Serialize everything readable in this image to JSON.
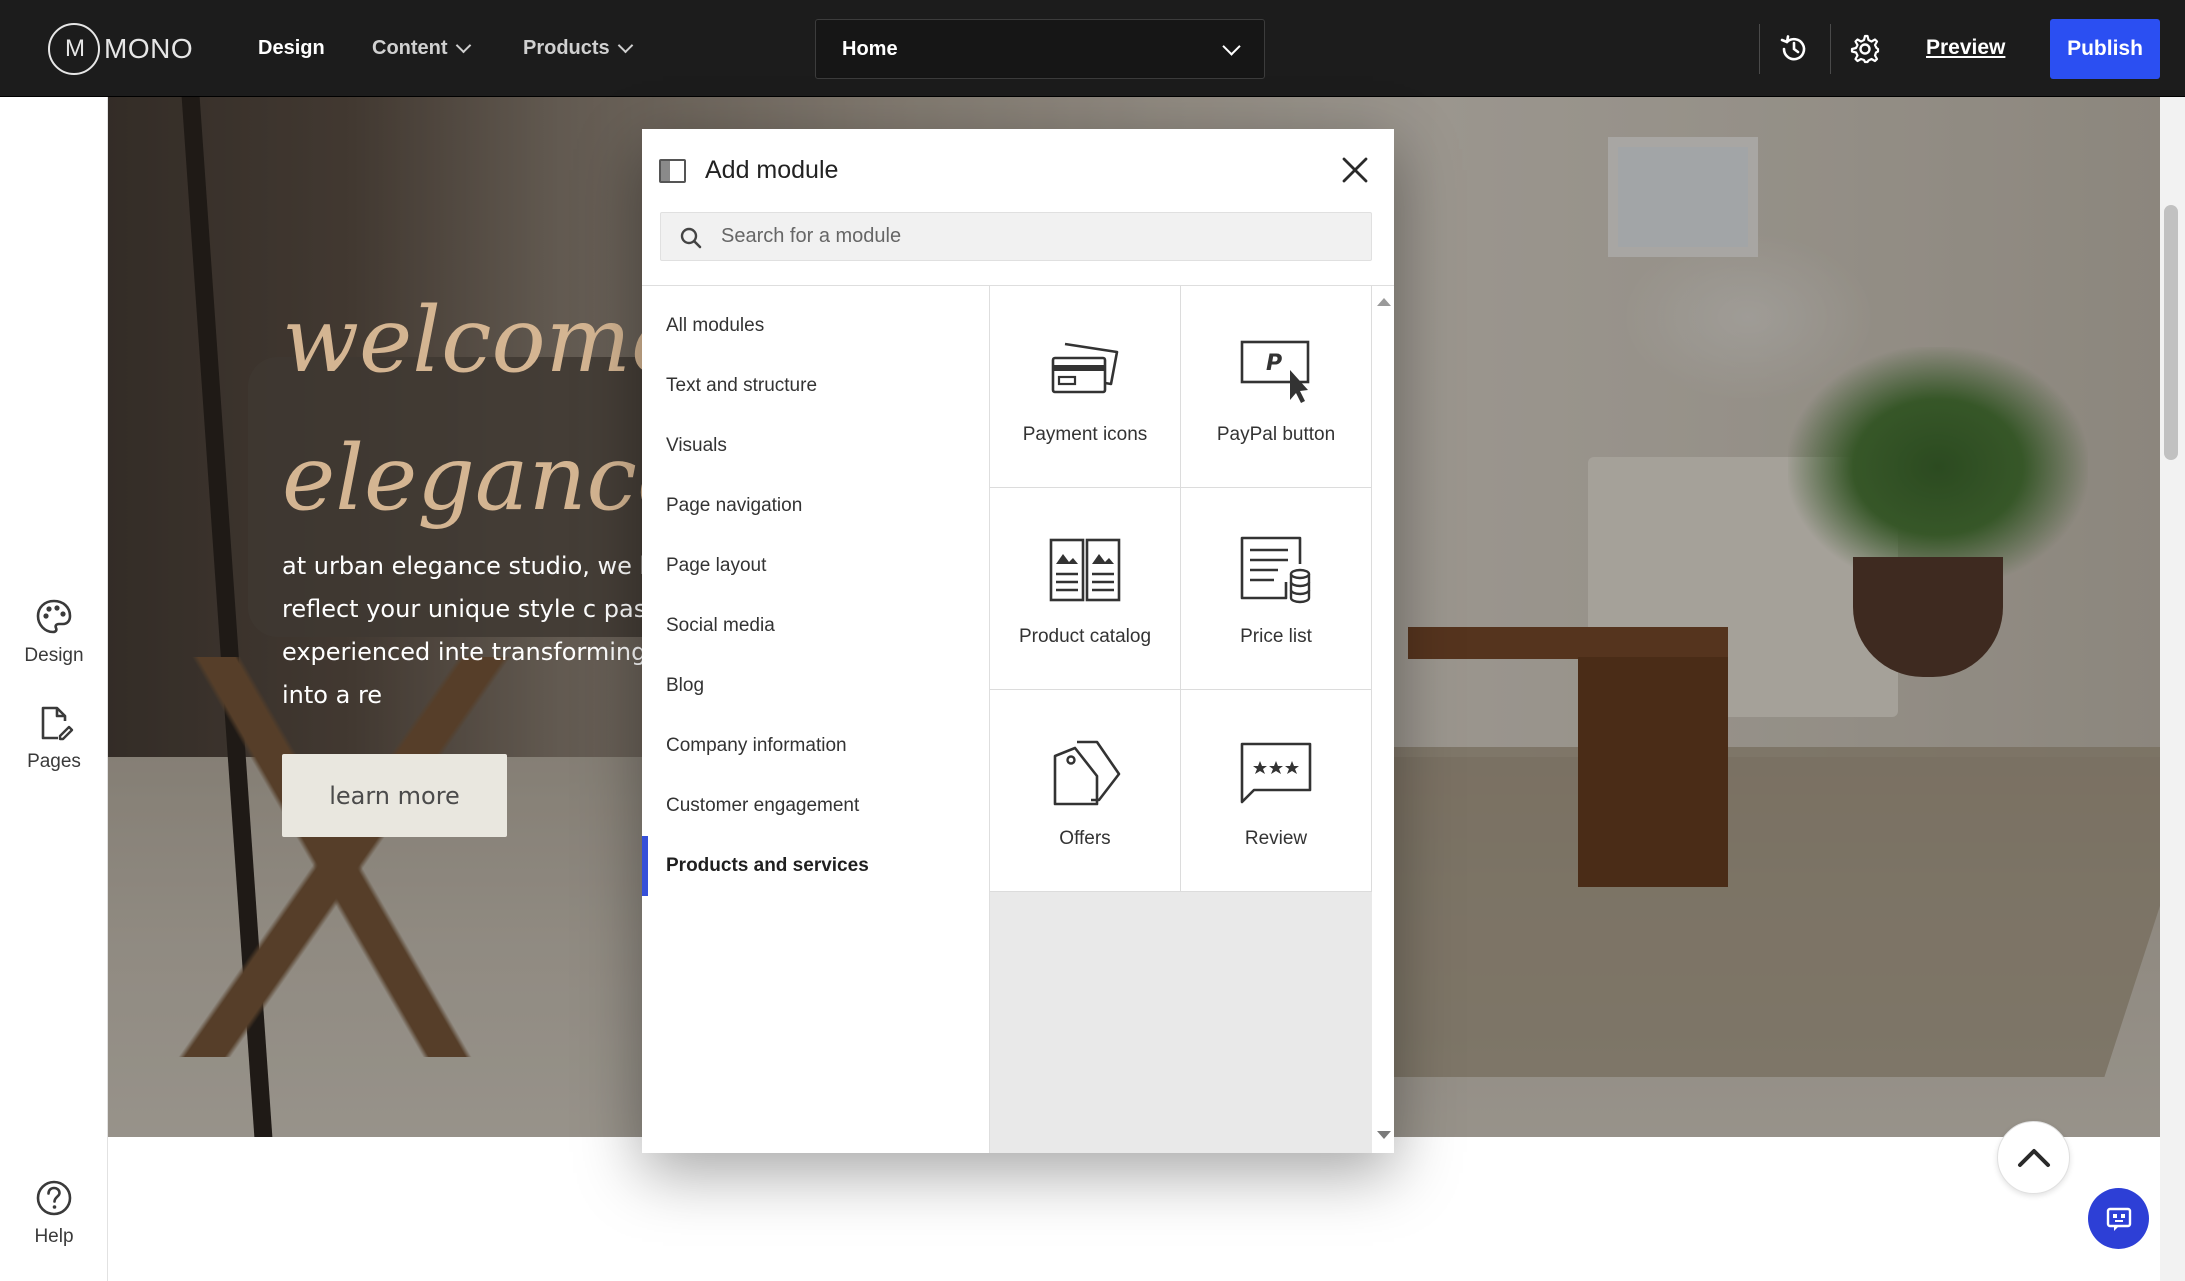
{
  "topbar": {
    "logo_text": "MONO",
    "logo_mark": "M",
    "nav": [
      {
        "label": "Design"
      },
      {
        "label": "Content"
      },
      {
        "label": "Products"
      }
    ],
    "page_select": "Home",
    "preview_label": "Preview",
    "publish_label": "Publish",
    "icons": [
      "history-icon",
      "gear-icon",
      "chevron-down-icon"
    ]
  },
  "sidebar": {
    "items": [
      {
        "label": "Design",
        "icon": "palette-icon"
      },
      {
        "label": "Pages",
        "icon": "page-edit-icon"
      },
      {
        "label": "Help",
        "icon": "help-icon"
      }
    ]
  },
  "hero": {
    "title": "welcome to\nelegance s",
    "body": "at urban elegance studio, we bel should reflect your unique style c passionate and experienced inte transforming your vision into a re",
    "cta": "learn more"
  },
  "modal": {
    "title": "Add module",
    "search_placeholder": "Search for a module",
    "categories": [
      "All modules",
      "Text and structure",
      "Visuals",
      "Page navigation",
      "Page layout",
      "Social media",
      "Blog",
      "Company information",
      "Customer engagement",
      "Products and services"
    ],
    "selected_category": "Products and services",
    "modules": [
      {
        "label": "Payment icons",
        "icon": "payment-cards-icon"
      },
      {
        "label": "PayPal button",
        "icon": "paypal-button-icon"
      },
      {
        "label": "Product catalog",
        "icon": "product-catalog-icon"
      },
      {
        "label": "Price list",
        "icon": "price-list-icon"
      },
      {
        "label": "Offers",
        "icon": "offers-tags-icon"
      },
      {
        "label": "Review",
        "icon": "review-stars-icon"
      }
    ]
  },
  "colors": {
    "topbar_bg": "#1c1c1c",
    "publish_bg": "#2b4ff2",
    "selected_accent": "#3650d9",
    "hero_title": "#d4b592",
    "chat_button": "#2d3fd6"
  }
}
